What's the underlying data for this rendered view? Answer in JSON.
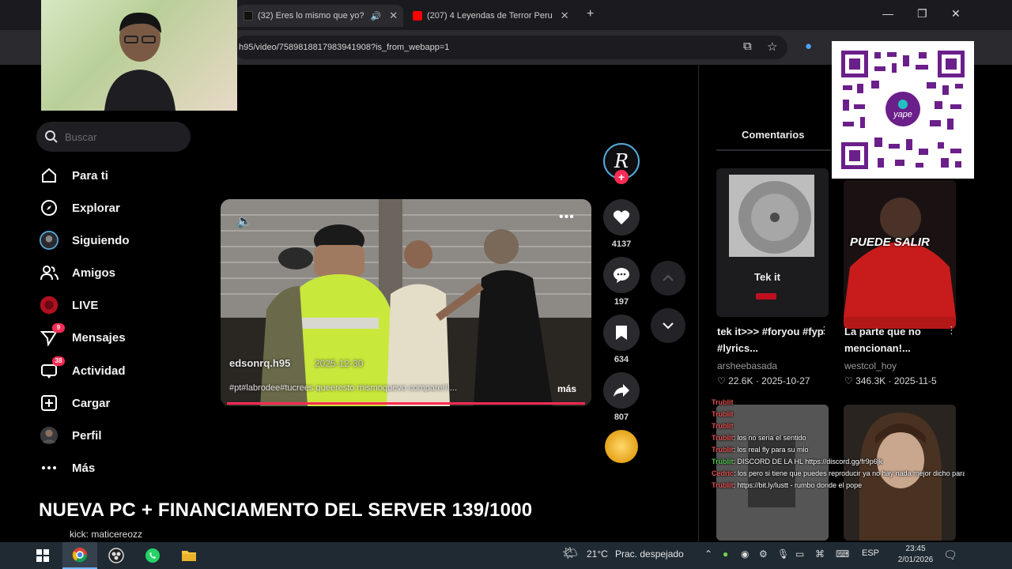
{
  "browser": {
    "tabs": [
      {
        "label": "(32) Eres lo mismo que yo?",
        "favicon_color": "#111111"
      },
      {
        "label": "(207) 4 Leyendas de Terror Peru",
        "favicon_color": "#ff0000"
      }
    ],
    "url": "h95/video/7589818817983941908?is_from_webapp=1"
  },
  "sidebar": {
    "search_placeholder": "Buscar",
    "items": [
      {
        "label": "Para ti",
        "icon": "home-icon"
      },
      {
        "label": "Explorar",
        "icon": "compass-icon"
      },
      {
        "label": "Siguiendo",
        "icon": "following-avatar-icon"
      },
      {
        "label": "Amigos",
        "icon": "friends-icon"
      },
      {
        "label": "LIVE",
        "icon": "live-icon"
      },
      {
        "label": "Mensajes",
        "icon": "messages-icon",
        "badge": "9"
      },
      {
        "label": "Actividad",
        "icon": "activity-icon",
        "badge": "38"
      },
      {
        "label": "Cargar",
        "icon": "upload-icon"
      },
      {
        "label": "Perfil",
        "icon": "profile-avatar-icon"
      },
      {
        "label": "Más",
        "icon": "more-dots-icon"
      }
    ]
  },
  "video": {
    "author": "edsonrq.h95",
    "date": "2025-12-30",
    "caption": "#pt#labrodee#tucrees queeresto mismoquevo compare!!!...",
    "more_label": "más",
    "progress": 1.0
  },
  "actions": {
    "likes": "4137",
    "comments": "197",
    "saves": "634",
    "shares": "807"
  },
  "right_panel": {
    "tab": "Comentarios",
    "cards": [
      {
        "thumb_text": "Tek it",
        "title": "tek it>>> #foryou #fyp #lyrics...",
        "user": "arsheebasada",
        "likes": "22.6K",
        "date": "2025-10-27"
      },
      {
        "thumb_text": "PUEDE SALIR",
        "title": "La parte que no mencionan!...",
        "user": "westcol_hoy",
        "likes": "346.3K",
        "date": "2025-11-5"
      }
    ]
  },
  "chat": [
    {
      "name": "Trublit",
      "text": ""
    },
    {
      "name": "Trublit",
      "text": ""
    },
    {
      "name": "Trublit",
      "text": ""
    },
    {
      "name": "Trublit",
      "text": ": los no seria el sentido"
    },
    {
      "name": "Trublit",
      "text": ": los real fly para su mio"
    },
    {
      "name": "Trublit",
      "text": ": DISCORD DE LA HL https://discord.gg/fr9p6jk"
    },
    {
      "name": "Cedric",
      "text": ": los pero si tiene que puedes reproducir ya no hay nada mejor dicho para apoyarme en el stream"
    },
    {
      "name": "Trublit",
      "text": ": https://bit.ly/lustt - rumbo donde el pope"
    }
  ],
  "overlay": {
    "title": "NUEVA PC + FINANCIAMENTO DEL SERVER 139/1000",
    "kick": "kick: maticereozz"
  },
  "taskbar": {
    "weather": "21°C",
    "weather_desc": "Prac. despejado",
    "lang": "ESP",
    "time": "23:45",
    "date": "2/01/2026"
  }
}
